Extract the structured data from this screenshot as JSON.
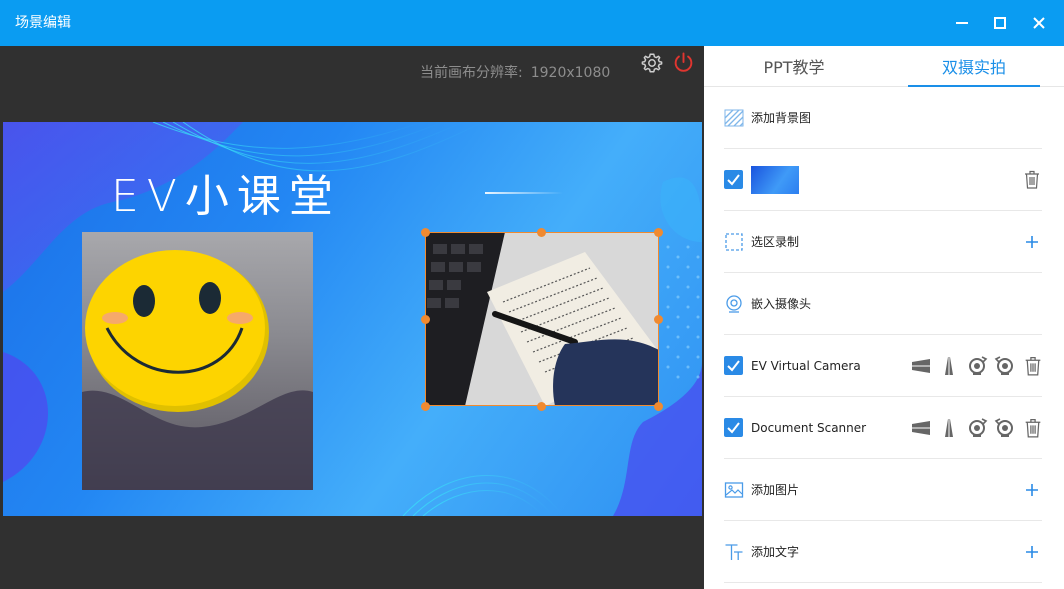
{
  "window": {
    "title": "场景编辑"
  },
  "preview": {
    "resolution_label": "当前画布分辨率:",
    "resolution_value": "1920x1080",
    "slide_title": "EV小课堂"
  },
  "tabs": [
    {
      "label": "PPT教学",
      "active": false
    },
    {
      "label": "双摄实拍",
      "active": true
    }
  ],
  "panel": {
    "add_background": "添加背景图",
    "region_record": "选区录制",
    "embed_camera": "嵌入摄像头",
    "camera_1": "EV Virtual Camera",
    "camera_2": "Document Scanner",
    "add_image": "添加图片",
    "add_text": "添加文字"
  },
  "colors": {
    "titlebar": "#0a9cf2",
    "accent": "#1a8fe8",
    "selection": "#f08a30",
    "power": "#e0352f"
  }
}
